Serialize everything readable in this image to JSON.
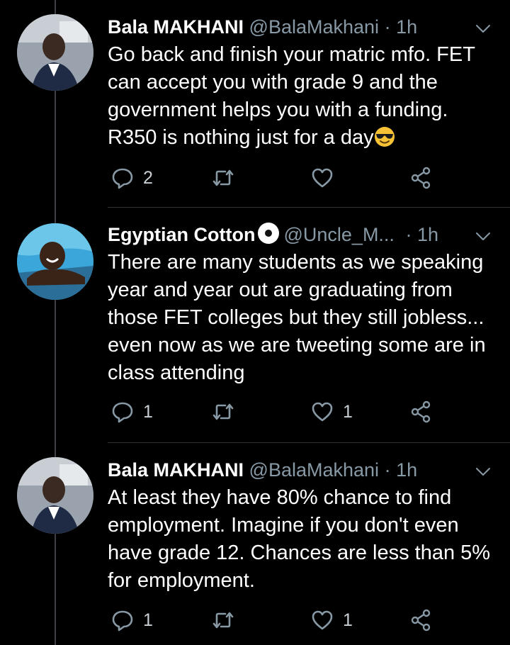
{
  "tweets": [
    {
      "name": "Bala MAKHANI",
      "handle": "@BalaMakhani",
      "separator": "·",
      "time": "1h",
      "verified": false,
      "text": "Go back and finish your matric mfo. FET can accept you with grade 9 and the government helps you with a funding. R350 is nothing just for a day",
      "trailing_emoji": "smiling-face-with-sunglasses-emoji",
      "reply_count": "2",
      "retweet_count": "",
      "like_count": "",
      "avatar": "man-in-car-avatar"
    },
    {
      "name": "Egyptian Cotton",
      "handle": "@Uncle_M...",
      "separator": "·",
      "time": "1h",
      "verified": true,
      "text": "There are many students as we speaking year and year out are graduating from those FET colleges but they still jobless... even now as we are tweeting some are in class attending",
      "trailing_emoji": "",
      "reply_count": "1",
      "retweet_count": "",
      "like_count": "1",
      "avatar": "child-in-pool-avatar"
    },
    {
      "name": "Bala MAKHANI",
      "handle": "@BalaMakhani",
      "separator": "·",
      "time": "1h",
      "verified": false,
      "text": "At least they have 80% chance to find employment. Imagine if you don't even have grade 12. Chances are less than 5% for employment.",
      "trailing_emoji": "",
      "reply_count": "1",
      "retweet_count": "",
      "like_count": "1",
      "avatar": "man-in-car-avatar"
    }
  ],
  "colors": {
    "background": "#000000",
    "text": "#ffffff",
    "secondary": "#8899a6",
    "divider": "#2f3336"
  }
}
